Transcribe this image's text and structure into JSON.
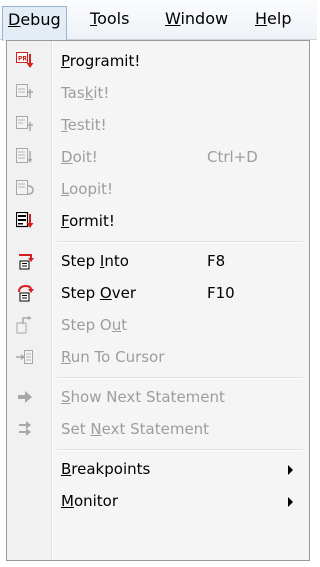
{
  "menubar": {
    "items": [
      {
        "label": "Debug",
        "mnemonic": "D",
        "rest": "ebug"
      },
      {
        "label": "Tools",
        "mnemonic": "T",
        "rest": "ools"
      },
      {
        "label": "Window",
        "mnemonic": "W",
        "rest": "indow"
      },
      {
        "label": "Help",
        "mnemonic": "H",
        "rest": "elp"
      }
    ]
  },
  "menu": {
    "programit": {
      "pre": "",
      "mnemonic": "P",
      "post": "rogramit!"
    },
    "taskit": {
      "pre": "Tas",
      "mnemonic": "k",
      "post": "it!"
    },
    "testit": {
      "pre": "",
      "mnemonic": "T",
      "post": "estit!"
    },
    "doit": {
      "pre": "",
      "mnemonic": "D",
      "post": "oit!",
      "accelerator": "Ctrl+D"
    },
    "loopit": {
      "pre": "",
      "mnemonic": "L",
      "post": "oopit!"
    },
    "formit": {
      "pre": "",
      "mnemonic": "F",
      "post": "ormit!"
    },
    "step_into": {
      "pre": "Step ",
      "mnemonic": "I",
      "post": "nto",
      "accelerator": "F8"
    },
    "step_over": {
      "pre": "Step ",
      "mnemonic": "O",
      "post": "ver",
      "accelerator": "F10"
    },
    "step_out": {
      "pre": "Step O",
      "mnemonic": "u",
      "post": "t"
    },
    "run_to_cursor": {
      "pre": "",
      "mnemonic": "R",
      "post": "un To Cursor"
    },
    "show_next": {
      "pre": "",
      "mnemonic": "S",
      "post": "how Next Statement"
    },
    "set_next": {
      "pre": "Set ",
      "mnemonic": "N",
      "post": "ext Statement"
    },
    "breakpoints": {
      "pre": "",
      "mnemonic": "B",
      "post": "reakpoints"
    },
    "monitor": {
      "pre": "",
      "mnemonic": "M",
      "post": "onitor"
    }
  },
  "colors": {
    "accent_red": "#d42020",
    "disabled_text": "#9d9d9d",
    "menubar_active_border": "#99b4d1"
  },
  "icons": {
    "programit": "program-run-icon",
    "taskit": "task-run-icon",
    "testit": "test-run-icon",
    "doit": "do-run-icon",
    "loopit": "loop-run-icon",
    "formit": "form-run-icon",
    "step_into": "step-into-icon",
    "step_over": "step-over-icon",
    "step_out": "step-out-icon",
    "run_to_cursor": "run-to-cursor-icon",
    "show_next": "show-next-statement-icon",
    "set_next": "set-next-statement-icon"
  }
}
